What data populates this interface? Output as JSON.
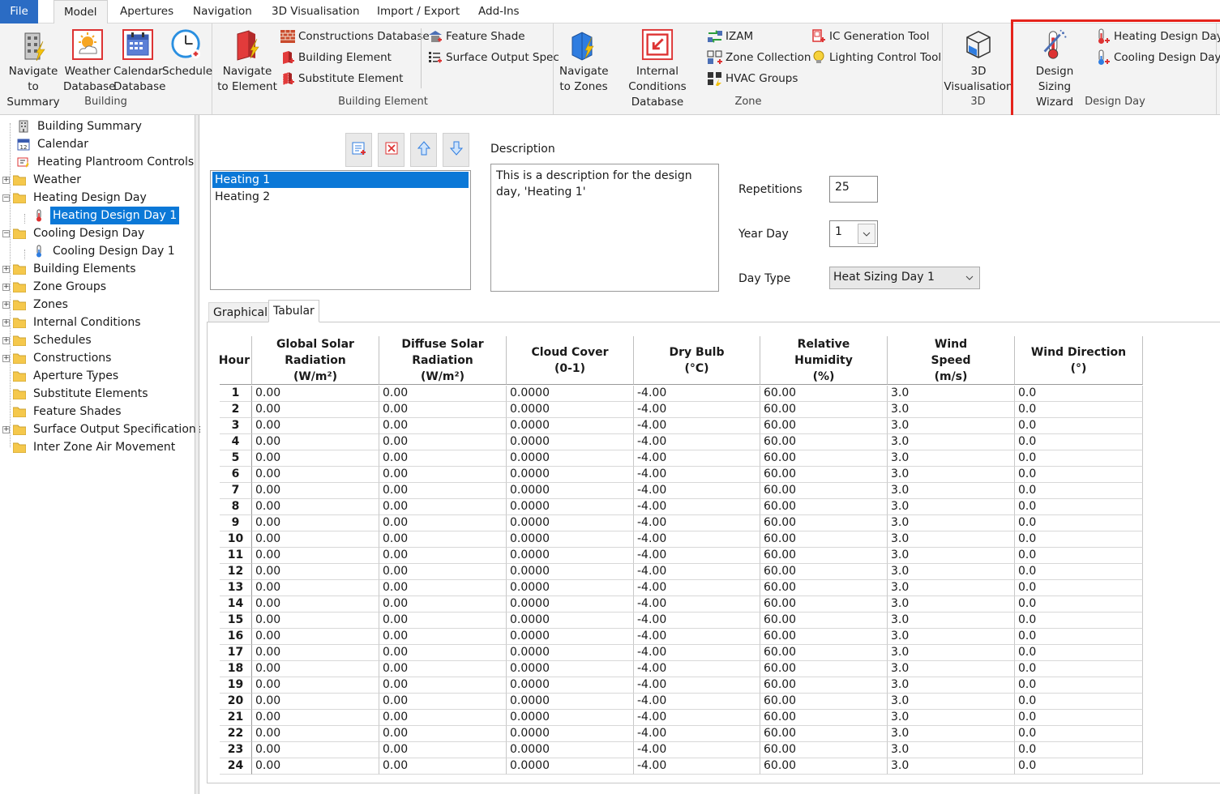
{
  "menu": {
    "tabs": [
      "File",
      "Model",
      "Apertures",
      "Navigation",
      "3D Visualisation",
      "Import / Export",
      "Add-Ins"
    ],
    "active": "Model"
  },
  "ribbon": {
    "building": {
      "label": "Building",
      "navigate_summary": [
        "Navigate to",
        "Summary"
      ],
      "weather_db": [
        "Weather",
        "Database"
      ],
      "calendar_db": [
        "Calendar",
        "Database"
      ],
      "schedule": "Schedule"
    },
    "building_element": {
      "label": "Building Element",
      "navigate_element": [
        "Navigate",
        "to Element"
      ],
      "constructions_db": "Constructions Database",
      "building_element": "Building Element",
      "substitute_element": "Substitute Element",
      "feature_shade": "Feature Shade",
      "surface_output_spec": "Surface Output Spec"
    },
    "zone": {
      "label": "Zone",
      "navigate_zones": [
        "Navigate",
        "to Zones"
      ],
      "internal_conditions_db": [
        "Internal Conditions",
        "Database"
      ],
      "izam": "IZAM",
      "zone_collection": "Zone Collection",
      "hvac_groups": "HVAC Groups",
      "ic_generation_tool": "IC Generation Tool",
      "lighting_control_tool": "Lighting Control Tool"
    },
    "threed": {
      "label": "3D",
      "visualisation": [
        "3D",
        "Visualisation"
      ]
    },
    "design_day": {
      "label": "Design Day",
      "design_sizing_wizard": [
        "Design",
        "Sizing Wizard"
      ],
      "heating_design_day": "Heating Design Day",
      "cooling_design_day": "Cooling Design Day"
    }
  },
  "tree": {
    "items": [
      "Building Summary",
      "Calendar",
      "Heating Plantroom Controls",
      "Weather",
      "Heating Design Day",
      "Heating Design Day 1",
      "Cooling Design Day",
      "Cooling Design Day 1",
      "Building Elements",
      "Zone Groups",
      "Zones",
      "Internal Conditions",
      "Schedules",
      "Constructions",
      "Aperture Types",
      "Substitute Elements",
      "Feature Shades",
      "Surface Output Specifications",
      "Inter Zone Air Movement"
    ],
    "selected": "Heating Design Day 1"
  },
  "editor": {
    "list": [
      "Heating 1",
      "Heating 2"
    ],
    "selected": "Heating 1",
    "description_label": "Description",
    "description": "This is a description for the design day, 'Heating 1'",
    "repetitions_label": "Repetitions",
    "repetitions": "25",
    "year_day_label": "Year Day",
    "year_day": "1",
    "day_type_label": "Day Type",
    "day_type": "Heat Sizing Day 1",
    "tabs": [
      "Graphical",
      "Tabular"
    ],
    "active_tab": "Tabular"
  },
  "table": {
    "columns": [
      {
        "label": "Hour",
        "display": "Hour"
      },
      {
        "label": "Global Solar Radiation (W/m²)",
        "lines": [
          "Global Solar",
          "Radiation",
          "(W/m²)"
        ]
      },
      {
        "label": "Diffuse Solar Radiation (W/m²)",
        "lines": [
          "Diffuse Solar",
          "Radiation",
          "(W/m²)"
        ]
      },
      {
        "label": "Cloud Cover (0-1)",
        "lines": [
          "Cloud Cover",
          "(0-1)"
        ]
      },
      {
        "label": "Dry Bulb (°C)",
        "lines": [
          "Dry Bulb",
          "(°C)"
        ]
      },
      {
        "label": "Relative Humidity (%)",
        "lines": [
          "Relative",
          "Humidity",
          "(%)"
        ]
      },
      {
        "label": "Wind Speed (m/s)",
        "lines": [
          "Wind",
          "Speed",
          "(m/s)"
        ]
      },
      {
        "label": "Wind Direction (°)",
        "lines": [
          "Wind Direction",
          "(°)"
        ]
      }
    ],
    "rows": [
      [
        "1",
        "0.00",
        "0.00",
        "0.0000",
        "-4.00",
        "60.00",
        "3.0",
        "0.0"
      ],
      [
        "2",
        "0.00",
        "0.00",
        "0.0000",
        "-4.00",
        "60.00",
        "3.0",
        "0.0"
      ],
      [
        "3",
        "0.00",
        "0.00",
        "0.0000",
        "-4.00",
        "60.00",
        "3.0",
        "0.0"
      ],
      [
        "4",
        "0.00",
        "0.00",
        "0.0000",
        "-4.00",
        "60.00",
        "3.0",
        "0.0"
      ],
      [
        "5",
        "0.00",
        "0.00",
        "0.0000",
        "-4.00",
        "60.00",
        "3.0",
        "0.0"
      ],
      [
        "6",
        "0.00",
        "0.00",
        "0.0000",
        "-4.00",
        "60.00",
        "3.0",
        "0.0"
      ],
      [
        "7",
        "0.00",
        "0.00",
        "0.0000",
        "-4.00",
        "60.00",
        "3.0",
        "0.0"
      ],
      [
        "8",
        "0.00",
        "0.00",
        "0.0000",
        "-4.00",
        "60.00",
        "3.0",
        "0.0"
      ],
      [
        "9",
        "0.00",
        "0.00",
        "0.0000",
        "-4.00",
        "60.00",
        "3.0",
        "0.0"
      ],
      [
        "10",
        "0.00",
        "0.00",
        "0.0000",
        "-4.00",
        "60.00",
        "3.0",
        "0.0"
      ],
      [
        "11",
        "0.00",
        "0.00",
        "0.0000",
        "-4.00",
        "60.00",
        "3.0",
        "0.0"
      ],
      [
        "12",
        "0.00",
        "0.00",
        "0.0000",
        "-4.00",
        "60.00",
        "3.0",
        "0.0"
      ],
      [
        "13",
        "0.00",
        "0.00",
        "0.0000",
        "-4.00",
        "60.00",
        "3.0",
        "0.0"
      ],
      [
        "14",
        "0.00",
        "0.00",
        "0.0000",
        "-4.00",
        "60.00",
        "3.0",
        "0.0"
      ],
      [
        "15",
        "0.00",
        "0.00",
        "0.0000",
        "-4.00",
        "60.00",
        "3.0",
        "0.0"
      ],
      [
        "16",
        "0.00",
        "0.00",
        "0.0000",
        "-4.00",
        "60.00",
        "3.0",
        "0.0"
      ],
      [
        "17",
        "0.00",
        "0.00",
        "0.0000",
        "-4.00",
        "60.00",
        "3.0",
        "0.0"
      ],
      [
        "18",
        "0.00",
        "0.00",
        "0.0000",
        "-4.00",
        "60.00",
        "3.0",
        "0.0"
      ],
      [
        "19",
        "0.00",
        "0.00",
        "0.0000",
        "-4.00",
        "60.00",
        "3.0",
        "0.0"
      ],
      [
        "20",
        "0.00",
        "0.00",
        "0.0000",
        "-4.00",
        "60.00",
        "3.0",
        "0.0"
      ],
      [
        "21",
        "0.00",
        "0.00",
        "0.0000",
        "-4.00",
        "60.00",
        "3.0",
        "0.0"
      ],
      [
        "22",
        "0.00",
        "0.00",
        "0.0000",
        "-4.00",
        "60.00",
        "3.0",
        "0.0"
      ],
      [
        "23",
        "0.00",
        "0.00",
        "0.0000",
        "-4.00",
        "60.00",
        "3.0",
        "0.0"
      ],
      [
        "24",
        "0.00",
        "0.00",
        "0.0000",
        "-4.00",
        "60.00",
        "3.0",
        "0.0"
      ]
    ]
  },
  "colors": {
    "accent": "#0b78d7",
    "file_tab": "#2b6cc4",
    "highlight": "#e5231b"
  }
}
